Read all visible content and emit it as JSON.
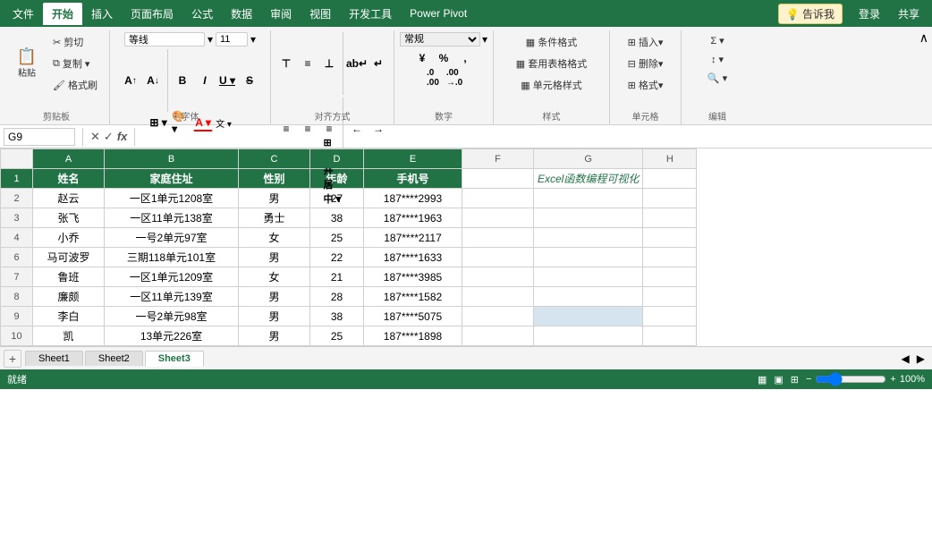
{
  "menu": {
    "items": [
      "文件",
      "开始",
      "插入",
      "页面布局",
      "公式",
      "数据",
      "审阅",
      "视图",
      "开发工具",
      "Power Pivot"
    ],
    "active": "开始",
    "tell": "告诉我",
    "login": "登录",
    "share": "共享"
  },
  "ribbon": {
    "clipboard_label": "剪贴板",
    "font_label": "字体",
    "align_label": "对齐方式",
    "number_label": "数字",
    "style_label": "样式",
    "cell_label": "单元格",
    "edit_label": "编辑",
    "paste_label": "粘贴",
    "cut_label": "✂",
    "copy_label": "⧉",
    "format_painter": "🖌",
    "font_name": "等线",
    "font_size": "11",
    "bold": "B",
    "italic": "I",
    "underline": "U",
    "strikethrough": "S",
    "font_size_inc": "A↑",
    "font_size_dec": "A↓",
    "font_color": "A",
    "fill_color": "🎨",
    "conditional_format": "条件格式",
    "table_format": "套用表格格式",
    "cell_style": "单元格样式",
    "insert_btn": "插入▾",
    "delete_btn": "删除▾",
    "format_btn": "格式▾",
    "sum_btn": "Σ▾",
    "sort_btn": "↕▾",
    "find_btn": "🔍▾"
  },
  "formula_bar": {
    "cell_ref": "G9",
    "formula": ""
  },
  "columns": {
    "headers": [
      "",
      "A",
      "B",
      "C",
      "D",
      "E",
      "F",
      "G",
      "H"
    ],
    "widths": [
      36,
      80,
      150,
      80,
      60,
      110,
      80,
      110,
      60
    ]
  },
  "rows": [
    {
      "num": "1",
      "cells": [
        "姓名",
        "家庭住址",
        "性别",
        "年龄",
        "手机号",
        "",
        "",
        ""
      ]
    },
    {
      "num": "2",
      "cells": [
        "赵云",
        "一区1单元1208室",
        "男",
        "27",
        "187****2993",
        "",
        "",
        ""
      ]
    },
    {
      "num": "3",
      "cells": [
        "张飞",
        "一区11单元138室",
        "勇士",
        "38",
        "187****1963",
        "",
        "",
        ""
      ]
    },
    {
      "num": "4",
      "cells": [
        "小乔",
        "一号2单元97室",
        "女",
        "25",
        "187****2117",
        "",
        "",
        ""
      ]
    },
    {
      "num": "6",
      "cells": [
        "马可波罗",
        "三期118单元101室",
        "男",
        "22",
        "187****1633",
        "",
        "",
        ""
      ]
    },
    {
      "num": "7",
      "cells": [
        "鲁班",
        "一区1单元1209室",
        "女",
        "21",
        "187****3985",
        "",
        "",
        ""
      ]
    },
    {
      "num": "8",
      "cells": [
        "廉颇",
        "一区11单元139室",
        "男",
        "28",
        "187****1582",
        "",
        "",
        ""
      ]
    },
    {
      "num": "9",
      "cells": [
        "李白",
        "一号2单元98室",
        "男",
        "38",
        "187****5075",
        "",
        "",
        ""
      ]
    },
    {
      "num": "10",
      "cells": [
        "凯",
        "13单元226室",
        "男",
        "25",
        "187****1898",
        "",
        "",
        ""
      ]
    }
  ],
  "special_cell": {
    "row": 1,
    "col": 6,
    "text": "Excel函数编程可视化"
  },
  "sheets": [
    "Sheet1",
    "Sheet2",
    "Sheet3"
  ],
  "active_sheet": "Sheet3",
  "selected_cell": "G9",
  "status": {
    "mode": "就绪",
    "right_info": ""
  }
}
